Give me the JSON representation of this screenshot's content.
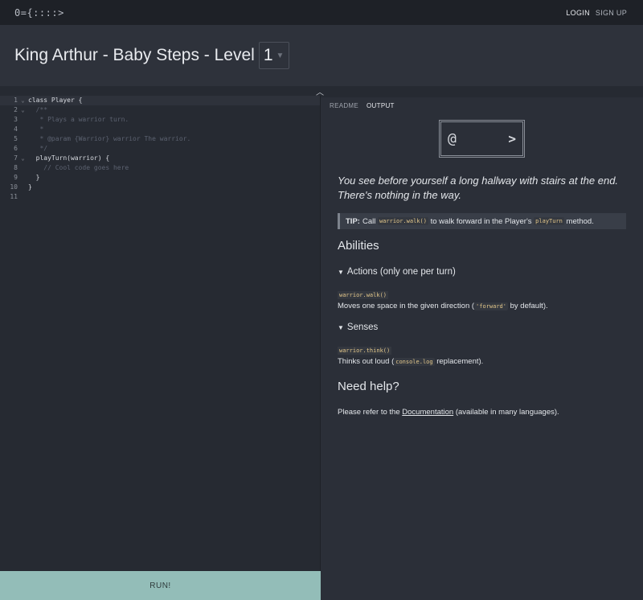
{
  "nav": {
    "logo": "0={::::>",
    "login": "LOGIN",
    "signup": "SIGN UP"
  },
  "title": {
    "text": "King Arthur - Baby Steps - Level",
    "level": "1"
  },
  "editor": {
    "lines": [
      {
        "n": "1",
        "fold": "⌄",
        "text": "class Player {",
        "kind": "code",
        "active": true
      },
      {
        "n": "2",
        "fold": "⌄",
        "text": "  /**",
        "kind": "comment"
      },
      {
        "n": "3",
        "fold": "",
        "text": "   * Plays a warrior turn.",
        "kind": "comment"
      },
      {
        "n": "4",
        "fold": "",
        "text": "   *",
        "kind": "comment"
      },
      {
        "n": "5",
        "fold": "",
        "text": "   * @param {Warrior} warrior The warrior.",
        "kind": "comment"
      },
      {
        "n": "6",
        "fold": "",
        "text": "   */",
        "kind": "comment"
      },
      {
        "n": "7",
        "fold": "⌄",
        "text": "  playTurn(warrior) {",
        "kind": "code"
      },
      {
        "n": "8",
        "fold": "",
        "text": "    // Cool code goes here",
        "kind": "comment"
      },
      {
        "n": "9",
        "fold": "",
        "text": "  }",
        "kind": "code"
      },
      {
        "n": "10",
        "fold": "",
        "text": "}",
        "kind": "code"
      },
      {
        "n": "11",
        "fold": "",
        "text": "",
        "kind": "code"
      }
    ]
  },
  "run": {
    "label": "RUN!"
  },
  "right": {
    "tabs": [
      "README",
      "OUTPUT"
    ],
    "map": {
      "warrior": "@",
      "stairs": ">"
    },
    "story": "You see before yourself a long hallway with stairs at the end. There's nothing in the way.",
    "tip": {
      "label": "TIP:",
      "pre": "Call",
      "code1": "warrior.walk()",
      "mid": "to walk forward in the Player's",
      "code2": "playTurn",
      "post": "method."
    },
    "abilities_heading": "Abilities",
    "actions_heading": "Actions (only one per turn)",
    "walk": {
      "name": "warrior.walk()",
      "desc_pre": "Moves one space in the given direction (",
      "desc_code": "'forward'",
      "desc_post": "by default)."
    },
    "senses_heading": "Senses",
    "think": {
      "name": "warrior.think()",
      "desc_pre": "Thinks out loud (",
      "desc_code": "console.log",
      "desc_post": "replacement)."
    },
    "help_heading": "Need help?",
    "help": {
      "pre": "Please refer to the",
      "link": "Documentation",
      "post": "(available in many languages)."
    }
  }
}
